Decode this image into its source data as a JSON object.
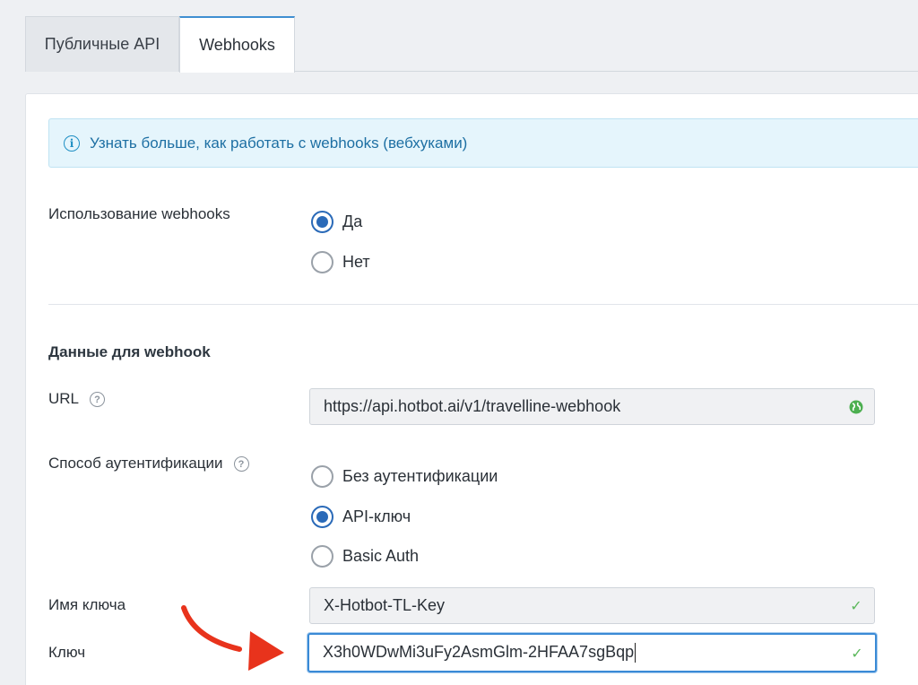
{
  "tabs": [
    {
      "label": "Публичные API",
      "active": false
    },
    {
      "label": "Webhooks",
      "active": true
    }
  ],
  "info": {
    "icon": "info-icon",
    "link_text": "Узнать больше, как работать с webhooks (вебхуками)"
  },
  "usage": {
    "label": "Использование webhooks",
    "options": [
      {
        "label": "Да",
        "selected": true
      },
      {
        "label": "Нет",
        "selected": false
      }
    ]
  },
  "section_title": "Данные для webhook",
  "url": {
    "label": "URL",
    "help_icon": "help-icon",
    "value": "https://api.hotbot.ai/v1/travelline-webhook",
    "suffix_icon": "globe-icon"
  },
  "auth": {
    "label": "Способ аутентификации",
    "help_icon": "help-icon",
    "options": [
      {
        "label": "Без аутентификации",
        "selected": false
      },
      {
        "label": "API-ключ",
        "selected": true
      },
      {
        "label": "Basic Auth",
        "selected": false
      }
    ]
  },
  "key_name": {
    "label": "Имя ключа",
    "value": "X-Hotbot-TL-Key",
    "suffix_icon": "check-icon"
  },
  "key": {
    "label": "Ключ",
    "value": "X3h0WDwMi3uFy2AsmGlm-2HFAA7sgBqp",
    "suffix_icon": "check-icon"
  },
  "colors": {
    "accent": "#2a6ab8",
    "info_bg": "#e5f5fc",
    "arrow": "#e8331c",
    "check": "#5cb85c"
  }
}
